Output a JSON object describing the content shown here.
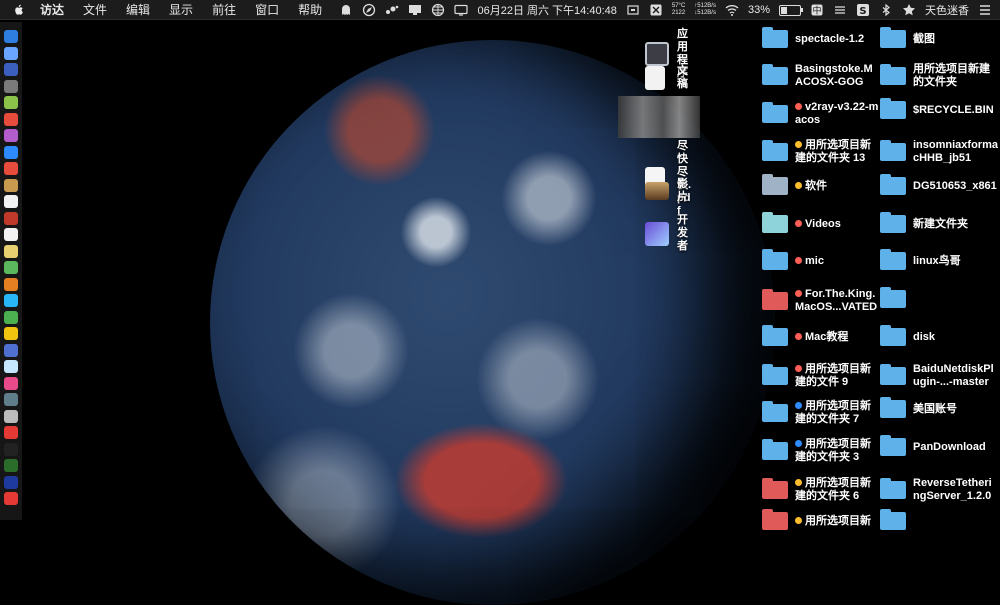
{
  "menubar": {
    "items": [
      "访达",
      "文件",
      "编辑",
      "显示",
      "前往",
      "窗口",
      "帮助"
    ],
    "status": {
      "datetime": "06月22日 周六 下午14:40:48",
      "temp": "57°C",
      "fan": "2122",
      "net_up": "↑512B/s",
      "net_down": "↓512B/s",
      "battery": "33%",
      "battery_level": 0.33,
      "user": "天色迷香"
    }
  },
  "apps": [
    {
      "label": "应用程序"
    },
    {
      "label": "文稿"
    },
    {
      "label": ""
    },
    {
      "label": "尽快尽快.pdf"
    },
    {
      "label": "影片"
    },
    {
      "label": "开发者"
    }
  ],
  "folders_col1": [
    {
      "label": "spectacle-1.2"
    },
    {
      "label": "Basingstoke.MACOSX-GOG"
    },
    {
      "label": "v2ray-v3.22-macos"
    },
    {
      "label": "用所选项目新建的文件夹 13"
    },
    {
      "label": "软件"
    },
    {
      "label": "Videos"
    },
    {
      "label": "mic"
    },
    {
      "label": "For.The.King.MacOS...VATED"
    },
    {
      "label": "Mac教程"
    },
    {
      "label": "用所选项目新建的文件 9"
    },
    {
      "label": "用所选项目新建的文件夹 7"
    },
    {
      "label": "用所选项目新建的文件夹 3"
    },
    {
      "label": "用所选项目新建的文件夹 6"
    },
    {
      "label": "用所选项目新"
    }
  ],
  "folders_col2": [
    {
      "label": "截图"
    },
    {
      "label": "用所选项目新建的文件夹"
    },
    {
      "label": "$RECYCLE.BIN"
    },
    {
      "label": "insomniaxformacHHB_jb51"
    },
    {
      "label": "DG510653_x861"
    },
    {
      "label": "新建文件夹"
    },
    {
      "label": "linux鸟哥"
    },
    {
      "label": ""
    },
    {
      "label": "disk"
    },
    {
      "label": "BaiduNetdiskPlugin-...-master"
    },
    {
      "label": "美国账号"
    },
    {
      "label": "PanDownload"
    },
    {
      "label": "ReverseTetheringServer_1.2.0"
    },
    {
      "label": ""
    }
  ]
}
